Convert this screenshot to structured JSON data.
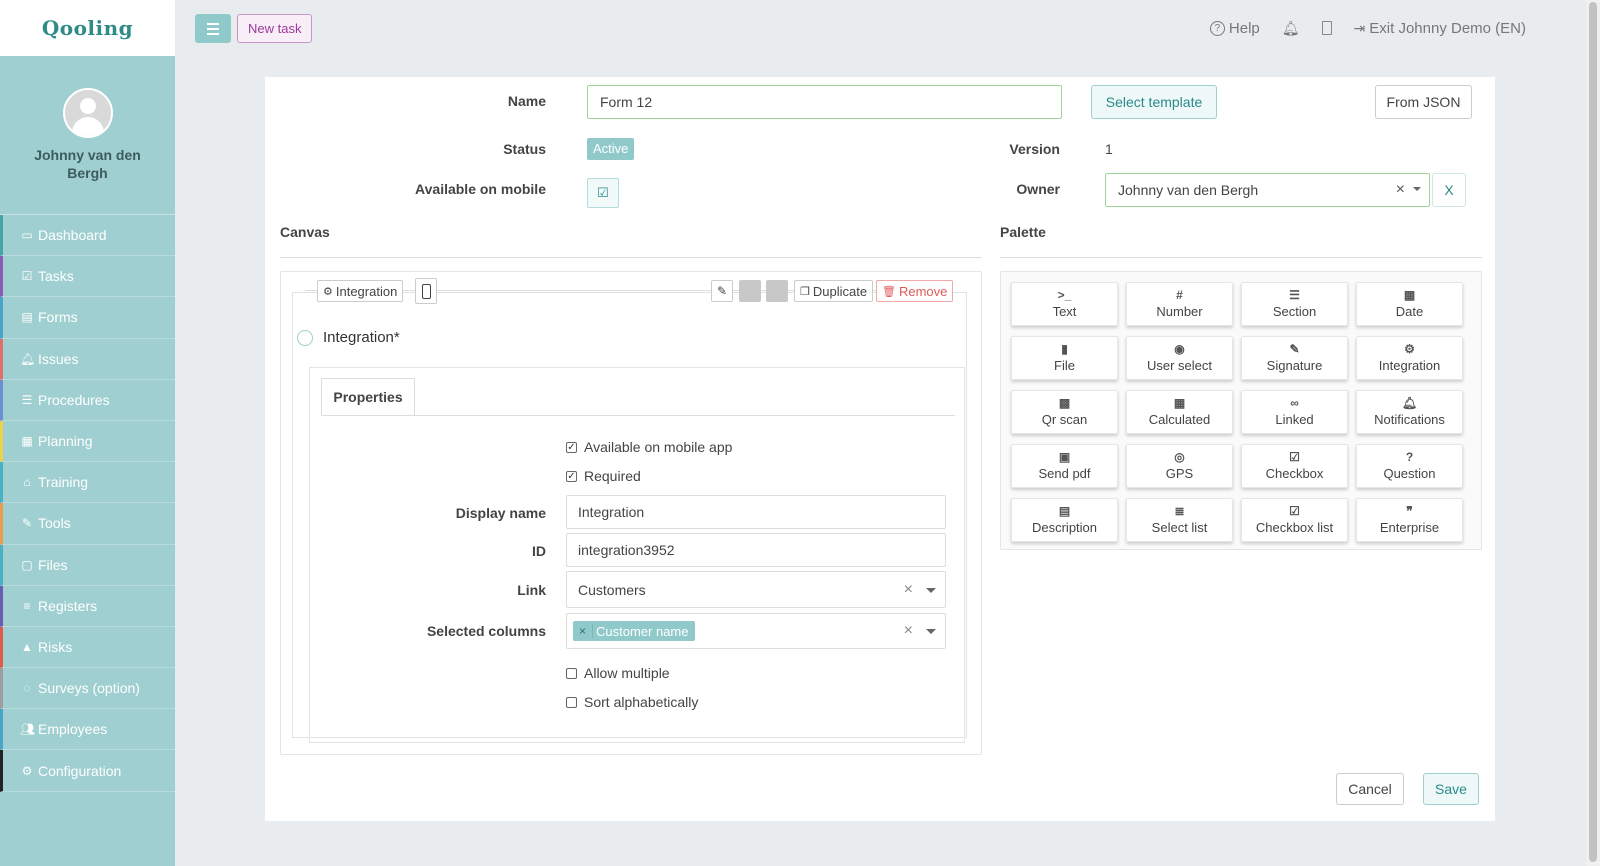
{
  "app": {
    "logo": "Qooling"
  },
  "user": {
    "name": "Johnny van den Bergh"
  },
  "nav": [
    {
      "label": "Dashboard",
      "icon": "monitor-icon",
      "glyph": "▭",
      "accent": "#45a5a6"
    },
    {
      "label": "Tasks",
      "icon": "check-square-icon",
      "glyph": "☑",
      "accent": "#8b5bb3"
    },
    {
      "label": "Forms",
      "icon": "file-icon",
      "glyph": "▤",
      "accent": "#4aa3c9"
    },
    {
      "label": "Issues",
      "icon": "bell-icon",
      "glyph": "🔔︎",
      "accent": "#e0706a"
    },
    {
      "label": "Procedures",
      "icon": "list-icon",
      "glyph": "☰",
      "accent": "#6d8fd1"
    },
    {
      "label": "Planning",
      "icon": "calendar-icon",
      "glyph": "▦",
      "accent": "#e8d34a"
    },
    {
      "label": "Training",
      "icon": "graduation-cap-icon",
      "glyph": "⌂",
      "accent": "#4ab0c4"
    },
    {
      "label": "Tools",
      "icon": "wrench-icon",
      "glyph": "✎",
      "accent": "#e89b4a"
    },
    {
      "label": "Files",
      "icon": "file-icon",
      "glyph": "▢",
      "accent": "#4ab0c4"
    },
    {
      "label": "Registers",
      "icon": "list-icon",
      "glyph": "≡",
      "accent": "#6a5bb3"
    },
    {
      "label": "Risks",
      "icon": "warning-icon",
      "glyph": "▲",
      "accent": "#e05a4a"
    },
    {
      "label": "Surveys (option)",
      "icon": "comments-icon",
      "glyph": "◌",
      "accent": "#9e9e9e"
    },
    {
      "label": "Employees",
      "icon": "users-icon",
      "glyph": "👥︎",
      "accent": "#45a5c6"
    },
    {
      "label": "Configuration",
      "icon": "gear-icon",
      "glyph": "⚙",
      "accent": "#222222"
    }
  ],
  "topbar": {
    "new_task": "New task",
    "help": "Help",
    "exit": "Exit Johnny Demo (EN)"
  },
  "form": {
    "name_label": "Name",
    "name_value": "Form 12",
    "select_template": "Select template",
    "from_json": "From JSON",
    "status_label": "Status",
    "status_value": "Active",
    "version_label": "Version",
    "version_value": "1",
    "mobile_label": "Available on mobile",
    "owner_label": "Owner",
    "owner_value": "Johnny van den Bergh",
    "owner_clear": "X",
    "canvas_title": "Canvas",
    "palette_title": "Palette",
    "cancel": "Cancel",
    "save": "Save"
  },
  "element": {
    "type_chip": "Integration",
    "duplicate": "Duplicate",
    "remove": "Remove",
    "title": "Integration*",
    "properties_tab": "Properties",
    "mobile_app": "Available on mobile app",
    "required": "Required",
    "display_name_label": "Display name",
    "display_name_value": "Integration",
    "id_label": "ID",
    "id_value": "integration3952",
    "link_label": "Link",
    "link_value": "Customers",
    "columns_label": "Selected columns",
    "columns_tag": "Customer name",
    "allow_multiple": "Allow multiple",
    "sort_alpha": "Sort alphabetically"
  },
  "palette": [
    {
      "label": "Text",
      "glyph": ">_"
    },
    {
      "label": "Number",
      "glyph": "#"
    },
    {
      "label": "Section",
      "glyph": "☰"
    },
    {
      "label": "Date",
      "glyph": "▦"
    },
    {
      "label": "File",
      "glyph": "▮"
    },
    {
      "label": "User select",
      "glyph": "◉"
    },
    {
      "label": "Signature",
      "glyph": "✎"
    },
    {
      "label": "Integration",
      "glyph": "⚙"
    },
    {
      "label": "Qr scan",
      "glyph": "▩"
    },
    {
      "label": "Calculated",
      "glyph": "▦"
    },
    {
      "label": "Linked",
      "glyph": "∞"
    },
    {
      "label": "Notifications",
      "glyph": "🔔︎"
    },
    {
      "label": "Send pdf",
      "glyph": "▣"
    },
    {
      "label": "GPS",
      "glyph": "◎"
    },
    {
      "label": "Checkbox",
      "glyph": "☑"
    },
    {
      "label": "Question",
      "glyph": "?"
    },
    {
      "label": "Description",
      "glyph": "▤"
    },
    {
      "label": "Select list",
      "glyph": "≣"
    },
    {
      "label": "Checkbox list",
      "glyph": "☑"
    },
    {
      "label": "Enterprise",
      "glyph": "❞"
    }
  ]
}
